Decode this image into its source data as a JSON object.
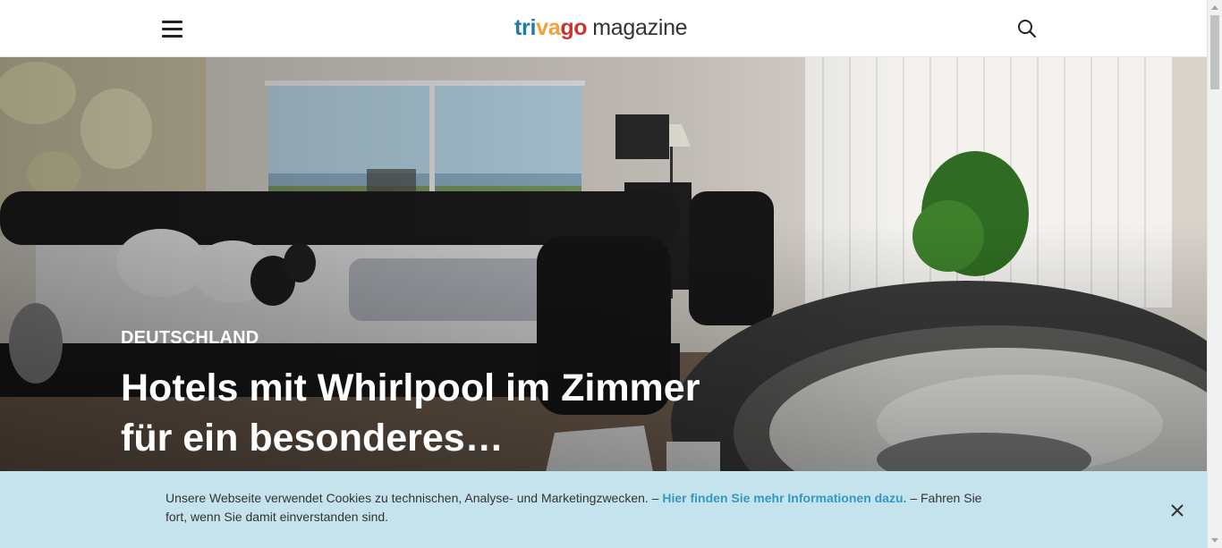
{
  "header": {
    "logo_brand": "trivago",
    "logo_suffix": "magazine",
    "menu_icon": "hamburger-icon",
    "search_icon": "search-icon"
  },
  "colors": {
    "tri": "#1f7aa8",
    "va": "#f2a23a",
    "go": "#cc3333",
    "cookie_bg": "#c5e3ed",
    "link": "#3399c2"
  },
  "hero": {
    "category": "DEUTSCHLAND",
    "title": "Hotels mit Whirlpool im Zimmer für ein besonderes…"
  },
  "cookie_banner": {
    "text_before": "Unsere Webseite verwendet Cookies zu technischen, Analyse- und Marketingzwecken. –",
    "link_text": "Hier finden Sie mehr Informationen dazu.",
    "text_after": "– Fahren Sie fort, wenn Sie damit einverstanden sind.",
    "close_icon": "close-icon"
  }
}
